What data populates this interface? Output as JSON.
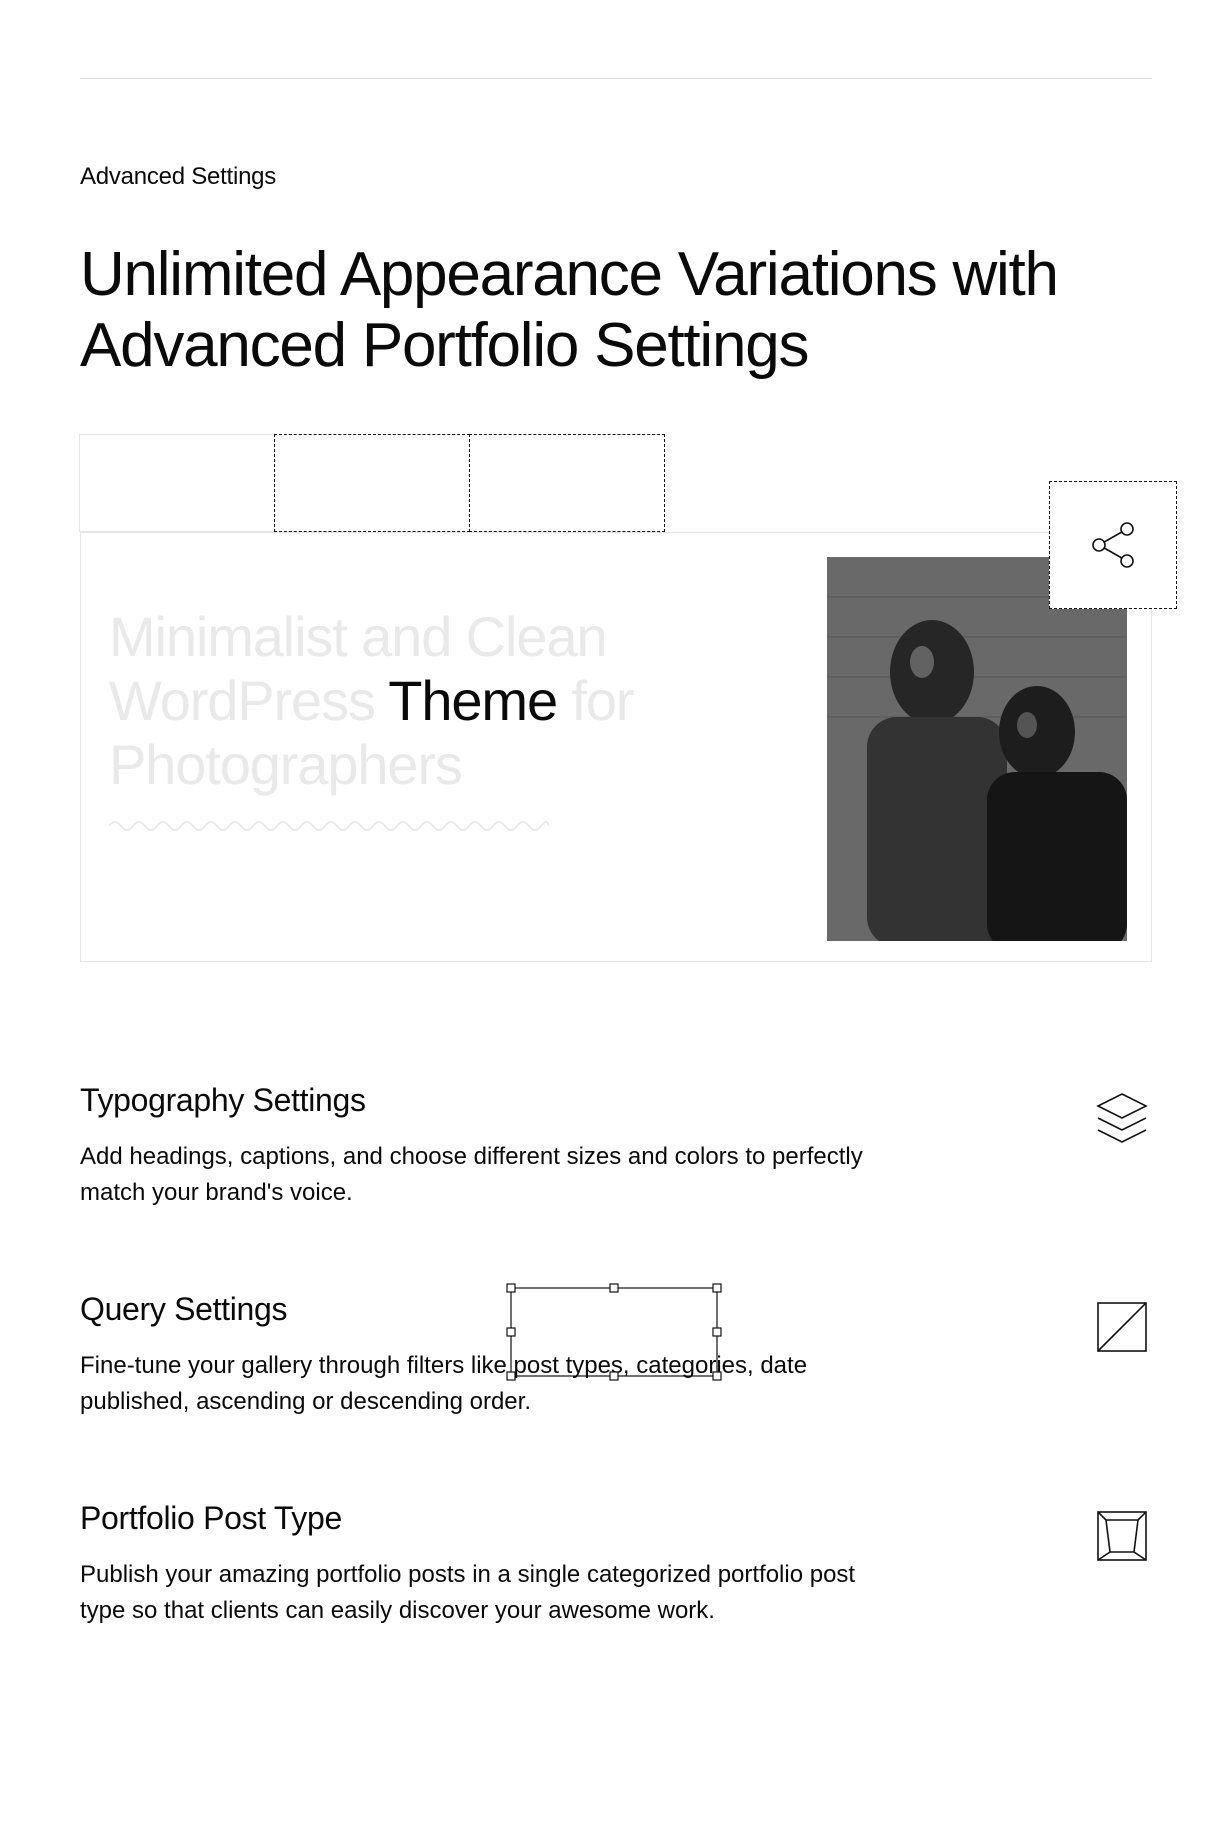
{
  "eyebrow": "Advanced Settings",
  "headline": "Unlimited Appearance Variations with Advanced Portfolio Settings",
  "editor": {
    "ghost_line1": "Minimalist and Clean",
    "ghost_line2_pre": "WordPress ",
    "ghost_line2_highlight": "Theme",
    "ghost_line2_post": " for",
    "ghost_line3": "Photographers"
  },
  "features": [
    {
      "title": "Typography Settings",
      "desc": "Add headings, captions, and choose different sizes and colors to perfectly match your brand's voice.",
      "icon": "layers-icon"
    },
    {
      "title": "Query Settings",
      "desc": "Fine-tune your gallery through filters like post types, categories, date published, ascending or descending order.",
      "icon": "square-slash-icon"
    },
    {
      "title": "Portfolio Post Type",
      "desc": "Publish your amazing portfolio posts in a single categorized portfolio post type so that clients can easily discover your awesome work.",
      "icon": "frame-icon"
    }
  ]
}
